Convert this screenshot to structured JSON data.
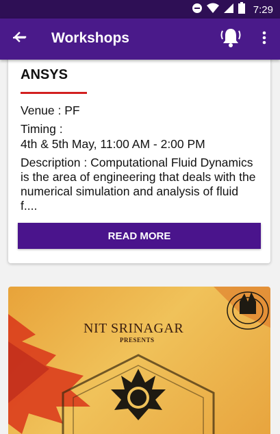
{
  "status_bar": {
    "time": "7:29",
    "icons": [
      "do-not-disturb-icon",
      "wifi-icon",
      "signal-icon",
      "battery-icon"
    ]
  },
  "app_bar": {
    "title": "Workshops",
    "back_icon": "back-arrow-icon",
    "notification_icon": "bell-icon",
    "menu_icon": "more-vert-icon"
  },
  "workshops": [
    {
      "title": "ANSYS",
      "venue": "Venue :  PF",
      "timing_label": "Timing :",
      "timing_value": "4th & 5th May, 11:00 AM - 2:00 PM",
      "description": "Description : Computational Fluid Dynamics is the area of engineering that deals with the numerical simulation and analysis of fluid f....",
      "button_label": "READ MORE"
    }
  ],
  "poster": {
    "heading": "NIT SRINAGAR",
    "subheading": "PRESENTS"
  },
  "colors": {
    "status_bar": "#2e0f55",
    "app_bar": "#4a1a8a",
    "button": "#4a148c",
    "accent_underline": "#d21f1f"
  }
}
